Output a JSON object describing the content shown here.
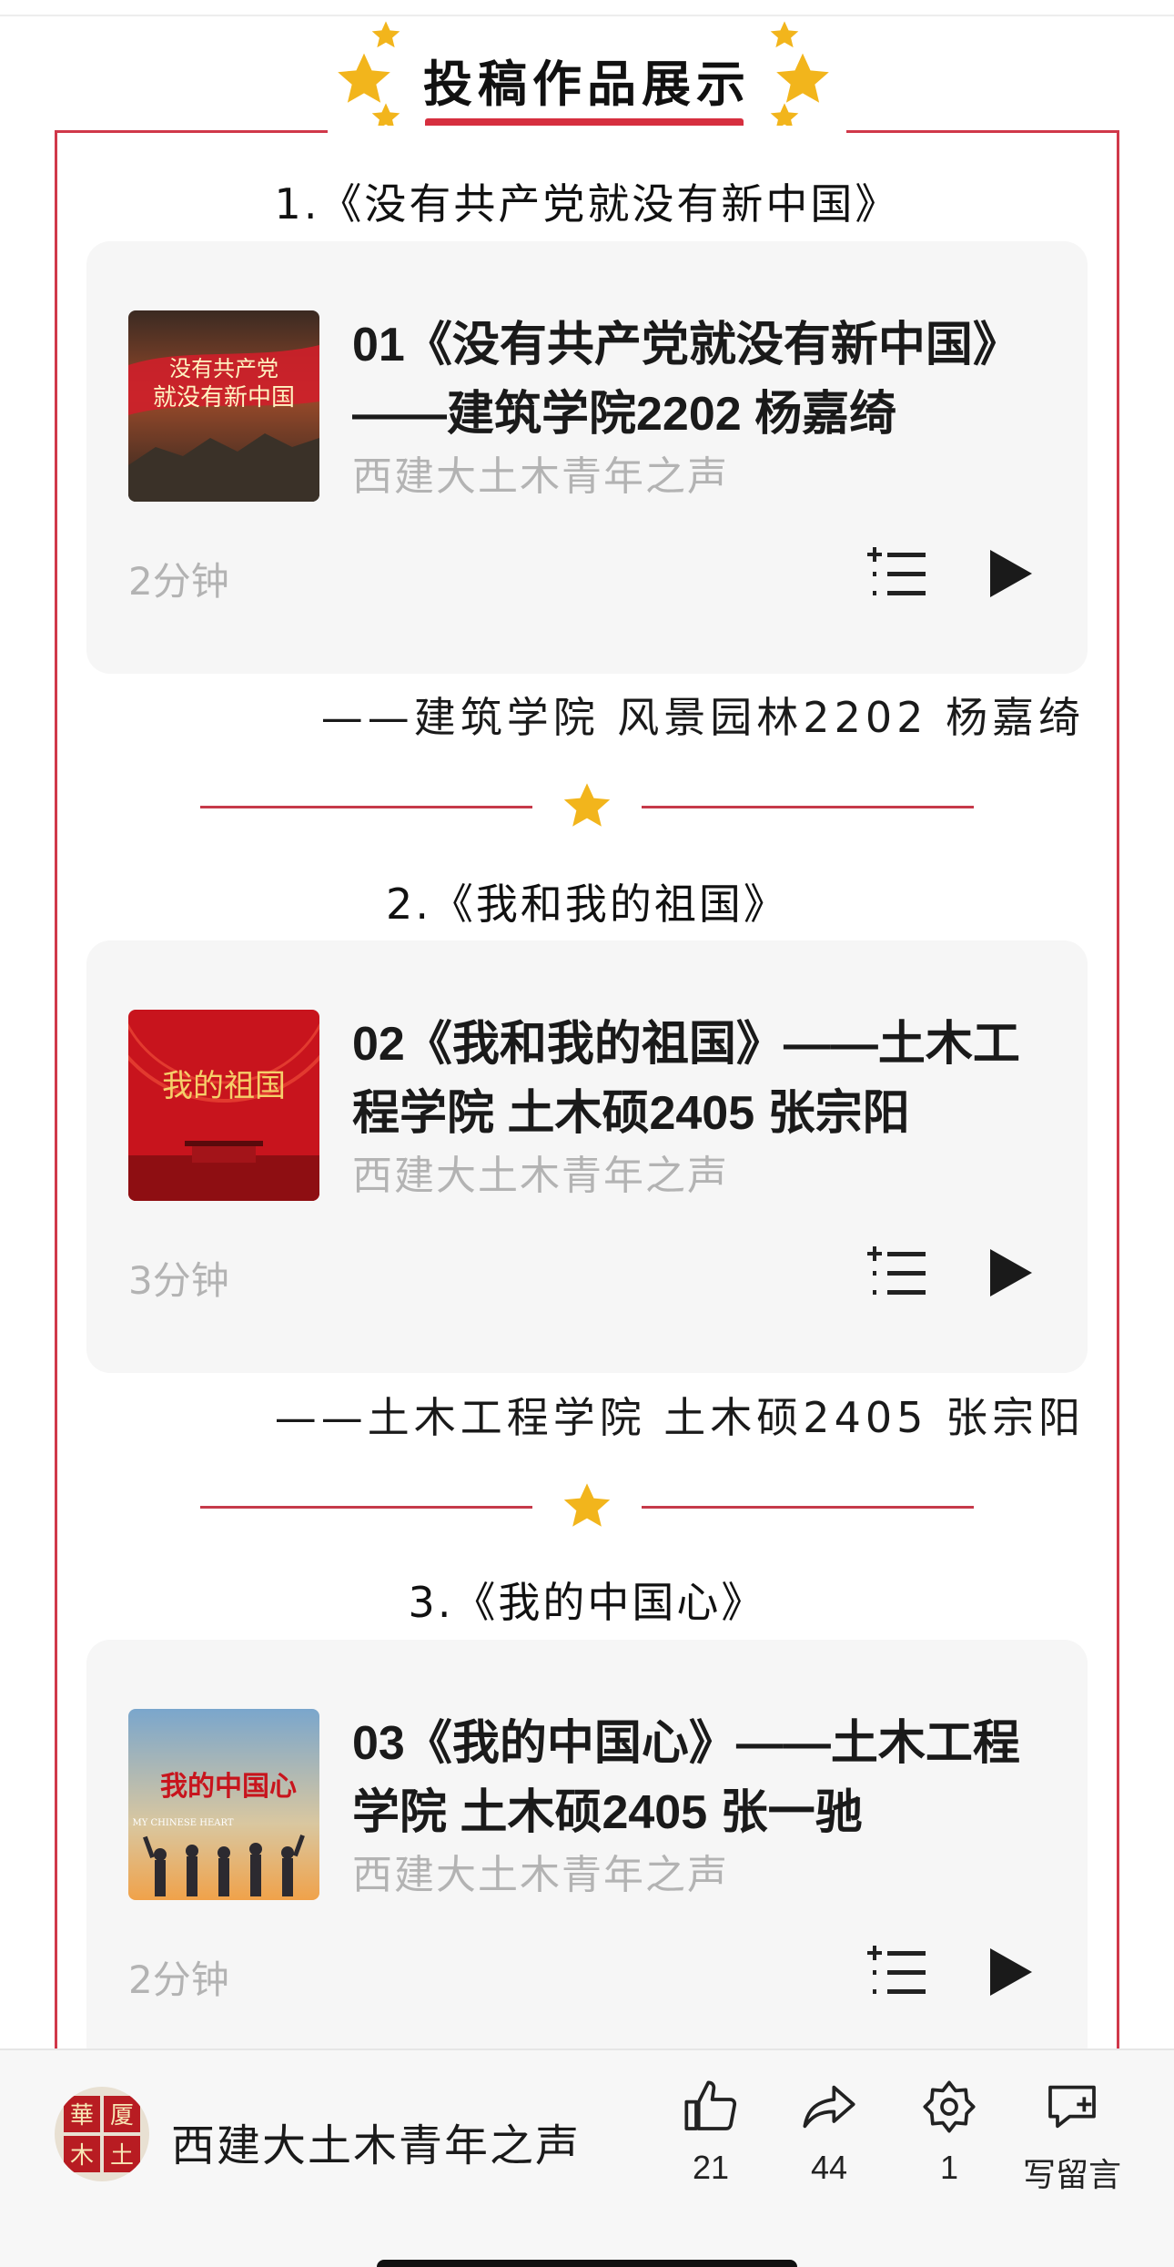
{
  "header": {
    "title": "投稿作品展示"
  },
  "sections": [
    {
      "title": "1.《没有共产党就没有新中国》",
      "card": {
        "title": "01《没有共产党就没有新中国》——建筑学院2202 杨嘉绮",
        "source": "西建大土木青年之声",
        "duration": "2分钟",
        "thumb_text": [
          "没有共产党",
          "就没有新中国"
        ]
      },
      "credit": "——建筑学院 风景园林2202 杨嘉绮"
    },
    {
      "title": "2.《我和我的祖国》",
      "card": {
        "title": "02《我和我的祖国》——土木工程学院 土木硕2405 张宗阳",
        "source": "西建大土木青年之声",
        "duration": "3分钟",
        "thumb_text": [
          "我的祖国"
        ]
      },
      "credit": "——土木工程学院 土木硕2405 张宗阳"
    },
    {
      "title": "3.《我的中国心》",
      "card": {
        "title": "03《我的中国心》——土木工程学院 土木硕2405 张一驰",
        "source": "西建大土木青年之声",
        "duration": "2分钟",
        "thumb_text": [
          "我的中国心",
          "MY CHINESE HEART"
        ]
      }
    }
  ],
  "bottom_bar": {
    "account_name": "西建大土木青年之声",
    "avatar_text": [
      "華",
      "厦",
      "木",
      "土"
    ],
    "like_count": "21",
    "share_count": "44",
    "favorite_count": "1",
    "comment_label": "写留言"
  },
  "colors": {
    "accent_red": "#d62f3f",
    "frame_red": "#d0384a",
    "star_gold": "#f2b51c",
    "card_bg": "#f6f6f6",
    "muted_text": "#b3b3b3"
  },
  "icons": [
    "star-icon",
    "playlist-add-icon",
    "play-icon",
    "like-icon",
    "share-icon",
    "favorite-icon",
    "comment-icon"
  ]
}
